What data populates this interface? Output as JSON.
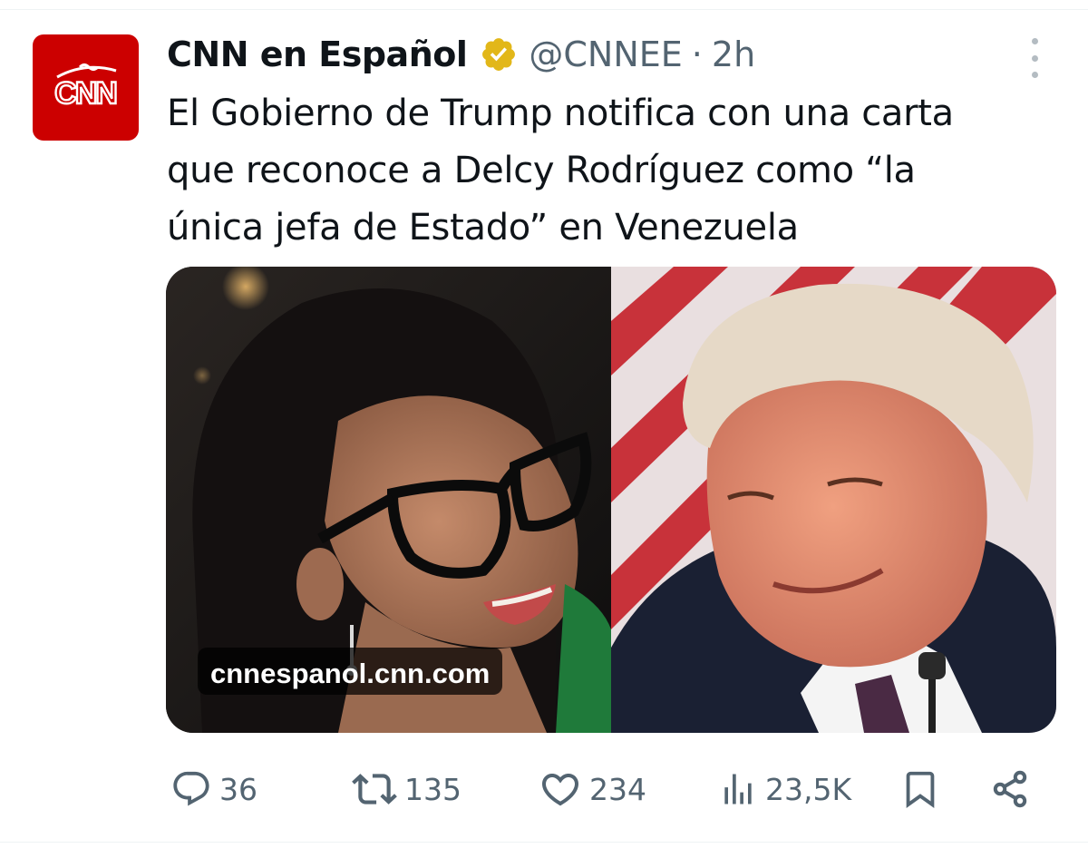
{
  "author": {
    "display_name": "CNN en Español",
    "handle": "@CNNEE",
    "separator": "·",
    "time": "2h",
    "avatar_text": "CNN",
    "verified": true,
    "avatar_color": "#cc0000",
    "verified_color": "#e2b719"
  },
  "tweet": {
    "lines": [
      "El Gobierno de Trump notifica con una carta",
      "que reconoce a Delcy Rodríguez como “la",
      "única jefa de Estado” en Venezuela"
    ]
  },
  "media": {
    "link_domain": "cnnespanol.cnn.com"
  },
  "actions": {
    "replies": {
      "icon": "reply-icon",
      "count": "36"
    },
    "reposts": {
      "icon": "repost-icon",
      "count": "135"
    },
    "likes": {
      "icon": "like-heart-icon",
      "count": "234"
    },
    "views": {
      "icon": "views-chart-icon",
      "count": "23,5K"
    },
    "bookmark": {
      "icon": "bookmark-icon"
    },
    "share": {
      "icon": "share-icon"
    }
  },
  "colors": {
    "text_primary": "#0f1419",
    "text_secondary": "#536471"
  }
}
